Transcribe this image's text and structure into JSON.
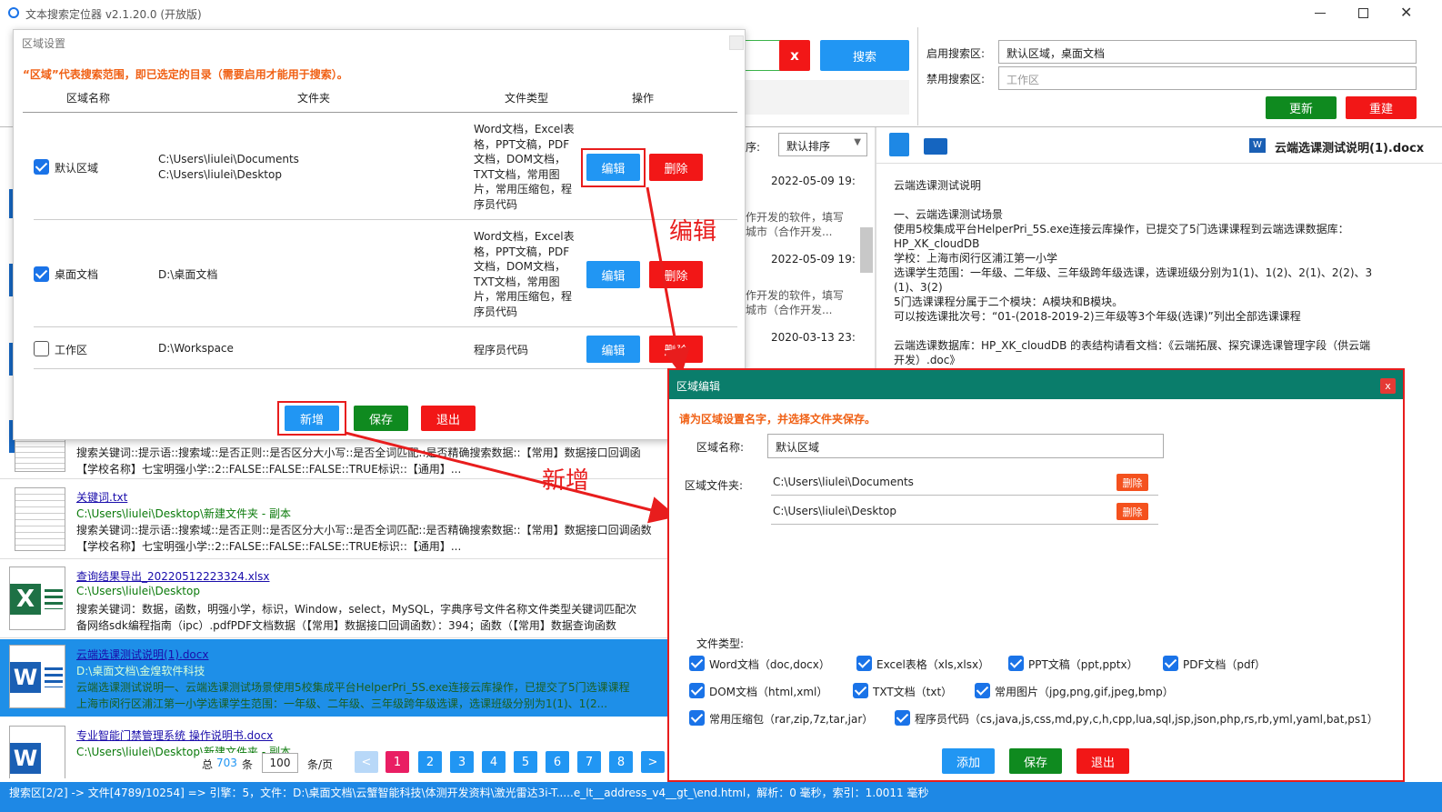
{
  "app": {
    "title": "文本搜索定位器 v2.1.20.0 (开放版)"
  },
  "toolbar": {
    "search_clear": "x",
    "search_btn": "搜索",
    "enabled_label": "启用搜索区:",
    "enabled_value": "默认区域，桌面文档",
    "disabled_label": "禁用搜索区:",
    "disabled_placeholder": "工作区",
    "update_btn": "更新",
    "rebuild_btn": "重建"
  },
  "sort": {
    "label": "序:",
    "value": "默认排序"
  },
  "results": [
    {
      "title": "",
      "path": "",
      "snippet1": "搜索关键词::提示语::搜索域::是否正则::是否区分大小写::是否全词匹配::是否精确搜索数据::【常用】数据接口回调函",
      "snippet2": "【学校名称】七宝明强小学::2::FALSE::FALSE::FALSE::TRUE标识::【通用】..."
    },
    {
      "title": "关键词.txt",
      "path": "C:\\Users\\liulei\\Desktop\\新建文件夹 - 副本",
      "snippet1": "搜索关键词::提示语::搜索域::是否正则::是否区分大小写::是否全词匹配::是否精确搜索数据::【常用】数据接口回调函数",
      "snippet2": "【学校名称】七宝明强小学::2::FALSE::FALSE::FALSE::TRUE标识::【通用】..."
    },
    {
      "title": "查询结果导出_20220512223324.xlsx",
      "path": "C:\\Users\\liulei\\Desktop",
      "snippet1": "搜索关键词：数据，函数，明强小学，标识，Window，select，MySQL，字典序号文件名称文件类型关键词匹配次",
      "snippet2": "备网络sdk编程指南（ipc）.pdfPDF文档数据（【常用】数据接口回调函数）：394；函数（【常用】数据查询函数"
    },
    {
      "title": "云端选课测试说明(1).docx",
      "path": "D:\\桌面文档\\金煌软件科技",
      "snippet1": "云端选课测试说明一、云端选课测试场景使用5校集成平台HelperPri_5S.exe连接云库操作，已提交了5门选课课程",
      "snippet2": "上海市闵行区浦江第一小学选课学生范围：一年级、二年级、三年级跨年级选课，选课班级分别为1(1)、1(2..."
    },
    {
      "title": "专业智能门禁管理系统 操作说明书.docx",
      "path": "C:\\Users\\liulei\\Desktop\\新建文件夹 - 副本",
      "snippet1": "",
      "snippet2": ""
    }
  ],
  "middle_rows": [
    {
      "date": "2022-05-09 19:",
      "t1": "作开发的软件，填写",
      "t2": "城市（合作开发..."
    },
    {
      "date": "2022-05-09 19:",
      "t1": "作开发的软件，填写",
      "t2": "城市（合作开发..."
    },
    {
      "date": "2020-03-13 23:",
      "t1": "",
      "t2": ""
    }
  ],
  "pagination": {
    "total_prefix": "总",
    "total": "703",
    "total_suffix": "条",
    "per_page": "100",
    "per_page_suffix": "条/页",
    "prev": "<",
    "next": ">",
    "pages": [
      "1",
      "2",
      "3",
      "4",
      "5",
      "6",
      "7",
      "8"
    ],
    "current": "1"
  },
  "status": {
    "text": "搜索区[2/2] -> 文件[4789/10254] => 引擎：5，文件：D:\\桌面文档\\云蟹智能科技\\体测开发资料\\激光雷达3i-T.....e_lt__address_v4__gt_\\end.html，解析：0 毫秒，索引：1.0011 毫秒"
  },
  "preview": {
    "filename": "云端选课测试说明(1).docx",
    "lines": [
      "云端选课测试说明",
      "",
      "一、云端选课测试场景",
      "使用5校集成平台HelperPri_5S.exe连接云库操作，已提交了5门选课课程到云端选课数据库：",
      "HP_XK_cloudDB",
      "学校：上海市闵行区浦江第一小学",
      "选课学生范围：一年级、二年级、三年级跨年级选课，选课班级分别为1(1)、1(2)、2(1)、2(2)、3",
      "(1)、3(2)",
      "5门选课课程分属于二个模块：A模块和B模块。",
      "可以按选课批次号：“01-(2018-2019-2)三年级等3个年级(选课)”列出全部选课课程",
      "",
      "云端选课数据库：HP_XK_cloudDB 的表结构请看文档：《云端拓展、探究课选课管理字段（供云端",
      "开发）.doc》"
    ]
  },
  "region_dialog": {
    "title": "区域设置",
    "close": "",
    "hint": "“区域”代表搜索范围，即已选定的目录（需要启用才能用于搜索）。",
    "headers": {
      "name": "区域名称",
      "folder": "文件夹",
      "types": "文件类型",
      "ops": "操作"
    },
    "rows": [
      {
        "checked": true,
        "name": "默认区域",
        "folders": [
          "C:\\Users\\liulei\\Documents",
          "C:\\Users\\liulei\\Desktop"
        ],
        "types": [
          "Word文档，Excel表",
          "格，PPT文稿，PDF",
          "文档，DOM文档，",
          "TXT文档，常用图",
          "片，常用压缩包，程",
          "序员代码"
        ]
      },
      {
        "checked": true,
        "name": "桌面文档",
        "folders": [
          "D:\\桌面文档"
        ],
        "types": [
          "Word文档，Excel表",
          "格，PPT文稿，PDF",
          "文档，DOM文档，",
          "TXT文档，常用图",
          "片，常用压缩包，程",
          "序员代码"
        ]
      },
      {
        "checked": false,
        "name": "工作区",
        "folders": [
          "D:\\Workspace"
        ],
        "types": [
          "程序员代码"
        ]
      }
    ],
    "edit": "编辑",
    "delete": "删除",
    "add": "新增",
    "save": "保存",
    "exit": "退出"
  },
  "annotations": {
    "edit": "编辑",
    "add": "新增"
  },
  "edit_dialog": {
    "title": "区域编辑",
    "close": "x",
    "hint": "请为区域设置名字，并选择文件夹保存。",
    "name_label": "区域名称:",
    "name_value": "默认区域",
    "folder_label": "区域文件夹:",
    "folders": [
      "C:\\Users\\liulei\\Documents",
      "C:\\Users\\liulei\\Desktop"
    ],
    "delete": "删除",
    "types_label": "文件类型:",
    "types": [
      "Word文档（doc,docx）",
      "Excel表格（xls,xlsx）",
      "PPT文稿（ppt,pptx）",
      "PDF文档（pdf）",
      "DOM文档（html,xml）",
      "TXT文档（txt）",
      "常用图片（jpg,png,gif,jpeg,bmp）",
      "常用压缩包（rar,zip,7z,tar,jar）",
      "程序员代码（cs,java,js,css,md,py,c,h,cpp,lua,sql,jsp,json,php,rs,rb,yml,yaml,bat,ps1）"
    ],
    "add": "添加",
    "save": "保存",
    "exit": "退出"
  },
  "colors": {
    "accent": "#2196f3",
    "danger": "#f21717",
    "ok": "#0f8a1f",
    "dialog_header": "#0a7d6b",
    "highlight": "#e81d1d"
  }
}
